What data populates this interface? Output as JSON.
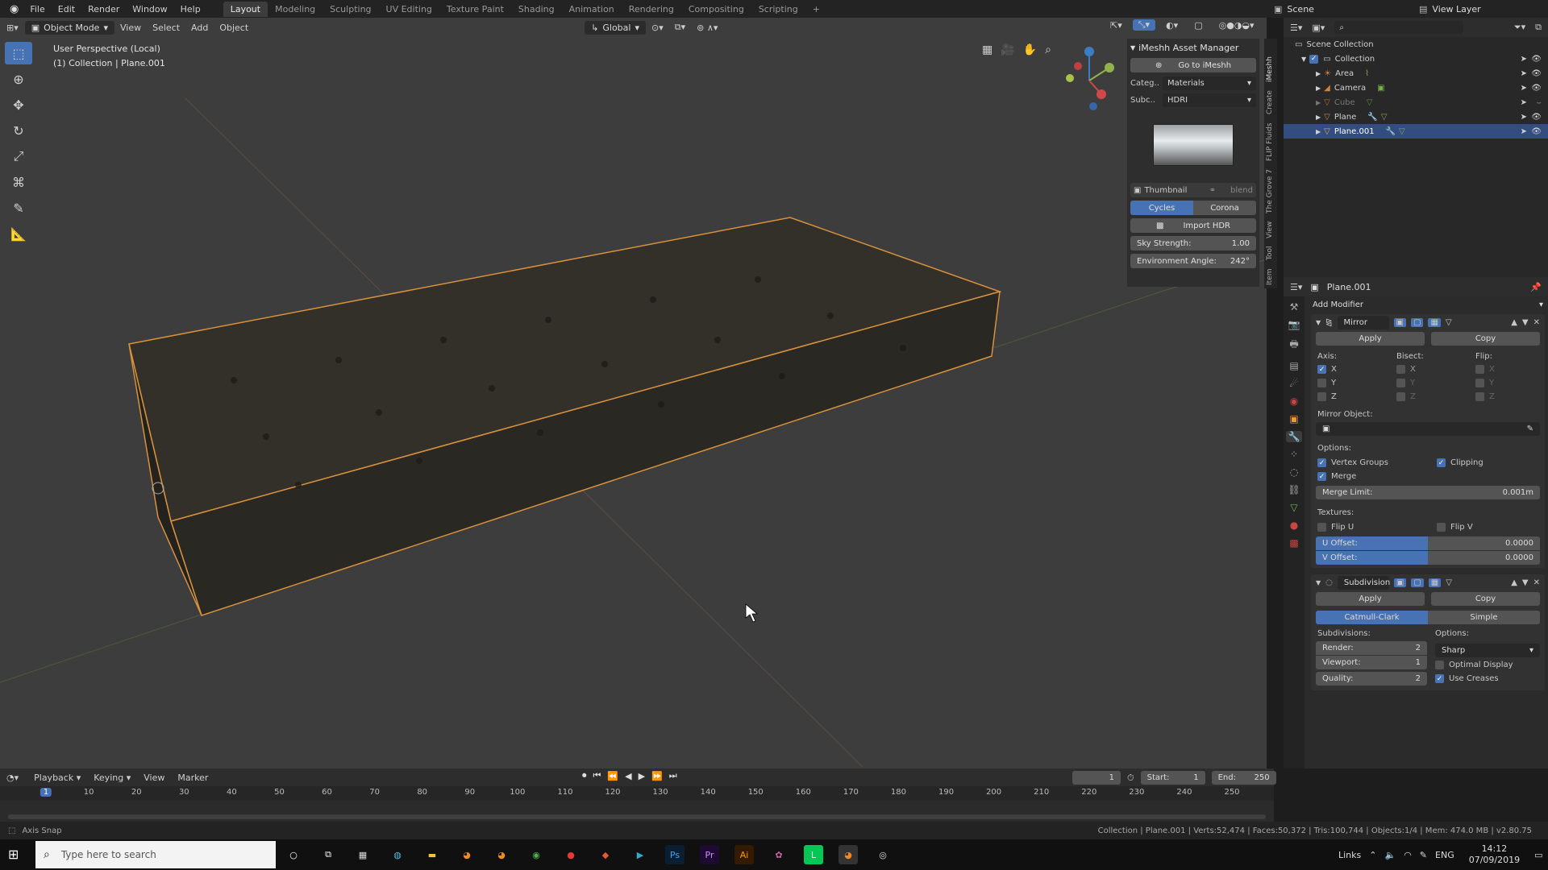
{
  "menu": {
    "items": [
      "File",
      "Edit",
      "Render",
      "Window",
      "Help"
    ],
    "workspaces": [
      "Layout",
      "Modeling",
      "Sculpting",
      "UV Editing",
      "Texture Paint",
      "Shading",
      "Animation",
      "Rendering",
      "Compositing",
      "Scripting"
    ],
    "add_workspace": "+",
    "scene_label": "Scene",
    "view_layer_label": "View Layer"
  },
  "viewport": {
    "mode": "Object Mode",
    "menus": [
      "View",
      "Select",
      "Add",
      "Object"
    ],
    "transform_orientation": "Global",
    "perspective_label": "User Perspective (Local)",
    "collection_label": "(1) Collection | Plane.001"
  },
  "imeshh": {
    "title": "iMeshh Asset Manager",
    "goto_label": "Go to iMeshh",
    "category_label": "Categ..",
    "category_value": "Materials",
    "subcategory_label": "Subc..",
    "subcategory_value": "HDRI",
    "thumbnail_label": "Thumbnail",
    "blend_label": "blend",
    "engines": [
      "Cycles",
      "Corona"
    ],
    "active_engine": "Cycles",
    "import_label": "Import HDR",
    "sky_strength_label": "Sky Strength:",
    "sky_strength_value": "1.00",
    "env_angle_label": "Environment Angle:",
    "env_angle_value": "242°",
    "side_tabs": [
      "Item",
      "Tool",
      "View",
      "The Grove 7",
      "FLIP Fluids",
      "Create",
      "iMeshh"
    ]
  },
  "outliner": {
    "root": "Scene Collection",
    "collection": "Collection",
    "items": [
      {
        "name": "Area",
        "selected": false
      },
      {
        "name": "Camera",
        "selected": false
      },
      {
        "name": "Cube",
        "selected": false
      },
      {
        "name": "Plane",
        "selected": false
      },
      {
        "name": "Plane.001",
        "selected": true
      }
    ]
  },
  "properties": {
    "object_name": "Plane.001",
    "add_modifier_label": "Add Modifier",
    "mirror": {
      "name": "Mirror",
      "apply_label": "Apply",
      "copy_label": "Copy",
      "axis_label": "Axis:",
      "bisect_label": "Bisect:",
      "flip_label": "Flip:",
      "axes": [
        "X",
        "Y",
        "Z"
      ],
      "axis_checked": [
        true,
        false,
        false
      ],
      "mirror_object_label": "Mirror Object:",
      "options_label": "Options:",
      "vertex_groups_label": "Vertex Groups",
      "clipping_label": "Clipping",
      "merge_label": "Merge",
      "merge_limit_label": "Merge Limit:",
      "merge_limit_value": "0.001m",
      "textures_label": "Textures:",
      "flip_u_label": "Flip U",
      "flip_v_label": "Flip V",
      "u_offset_label": "U Offset:",
      "u_offset_value": "0.0000",
      "v_offset_label": "V Offset:",
      "v_offset_value": "0.0000"
    },
    "subdivision": {
      "name": "Subdivision",
      "apply_label": "Apply",
      "copy_label": "Copy",
      "types": [
        "Catmull-Clark",
        "Simple"
      ],
      "active_type": "Catmull-Clark",
      "subdivisions_label": "Subdivisions:",
      "options_label": "Options:",
      "render_label": "Render:",
      "render_value": "2",
      "viewport_label": "Viewport:",
      "viewport_value": "1",
      "quality_label": "Quality:",
      "quality_value": "2",
      "uv_mode": "Sharp",
      "optimal_display_label": "Optimal Display",
      "use_creases_label": "Use Creases"
    }
  },
  "timeline": {
    "menus": [
      "Playback",
      "Keying",
      "View",
      "Marker"
    ],
    "current_frame": "1",
    "start_label": "Start:",
    "start_value": "1",
    "end_label": "End:",
    "end_value": "250",
    "ticks": [
      "1",
      "10",
      "20",
      "30",
      "40",
      "50",
      "60",
      "70",
      "80",
      "90",
      "100",
      "110",
      "120",
      "130",
      "140",
      "150",
      "160",
      "170",
      "180",
      "190",
      "200",
      "210",
      "220",
      "230",
      "240",
      "250"
    ]
  },
  "status": {
    "left": "Axis Snap",
    "right": "Collection | Plane.001 | Verts:52,474 | Faces:50,372 | Tris:100,744 | Objects:1/4 | Mem: 474.0 MB | v2.80.75"
  },
  "taskbar": {
    "search_placeholder": "Type here to search",
    "links_label": "Links",
    "language": "ENG",
    "time": "14:12",
    "date": "07/09/2019",
    "apps": [
      "calculator",
      "app",
      "file-explorer",
      "blender",
      "blender",
      "chrome",
      "app",
      "app",
      "app",
      "photoshop",
      "premiere",
      "illustrator",
      "app",
      "line",
      "blender",
      "app"
    ]
  },
  "colors": {
    "accent": "#4772b3",
    "selection_outline": "#e89a3c",
    "viewport_bg": "#3d3d3d"
  }
}
